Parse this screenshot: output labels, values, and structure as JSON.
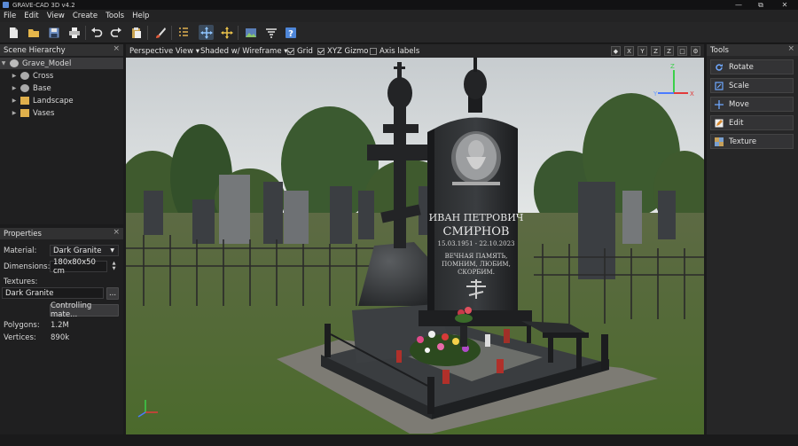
{
  "app": {
    "title": "GRAVE-CAD 3D v4.2"
  },
  "window_controls": {
    "minimize": "—",
    "maximize": "⧉",
    "close": "✕"
  },
  "menu": [
    "File",
    "Edit",
    "View",
    "Create",
    "Tools",
    "Help"
  ],
  "toolbar": [
    "new-file-icon",
    "open-folder-icon",
    "save-icon",
    "print-icon",
    "undo-icon",
    "redo-icon",
    "paste-icon",
    "brush-icon",
    "grid-select-icon",
    "move-icon",
    "transform-icon",
    "image-icon",
    "layers-icon",
    "help-icon"
  ],
  "hierarchy": {
    "title": "Scene Hierarchy",
    "close": "×",
    "root": "Grave_Model",
    "items": [
      "Cross",
      "Base",
      "Landscape",
      "Vases"
    ]
  },
  "properties": {
    "title": "Properties",
    "close": "×",
    "material_label": "Material:",
    "material_value": "Dark Granite",
    "dimensions_label": "Dimensions:",
    "dimensions_value": "180x80x50 cm",
    "textures_label": "Textures:",
    "texture_value": "Dark Granite",
    "browse": "...",
    "control_button": "Controlling mate...",
    "polygons_label": "Polygons:",
    "polygons_value": "1.2M",
    "vertices_label": "Vertices:",
    "vertices_value": "890k"
  },
  "viewport_bar": {
    "view": "Perspective View ▾",
    "shading": "Shaded w/ Wireframe ▾",
    "grid": "Grid",
    "gizmo": "XYZ Gizmo",
    "axis_labels": "Axis labels",
    "view_buttons": [
      "X",
      "Y",
      "Z",
      "Z"
    ]
  },
  "tools": {
    "title": "Tools",
    "close": "×",
    "items": [
      "Rotate",
      "Scale",
      "Move",
      "Edit",
      "Texture"
    ]
  },
  "headstone": {
    "name_line1": "ИВАН ПЕТРОВИЧ",
    "name_line2": "СМИРНОВ",
    "dates": "15.03.1951 - 22.10.2023",
    "epitaph": [
      "ВЕЧНАЯ ПАМЯТЬ,",
      "ПОМНИМ, ЛЮБИМ,",
      "СКОРБИМ."
    ]
  },
  "gizmo": {
    "x": "X",
    "y": "Y",
    "z": "Z"
  },
  "colors": {
    "accent": "#3a4a5c",
    "granite": "#1e2022",
    "gizmo_x": "#e23b3b",
    "gizmo_y": "#3bd04a",
    "gizmo_z": "#4a7bff"
  }
}
